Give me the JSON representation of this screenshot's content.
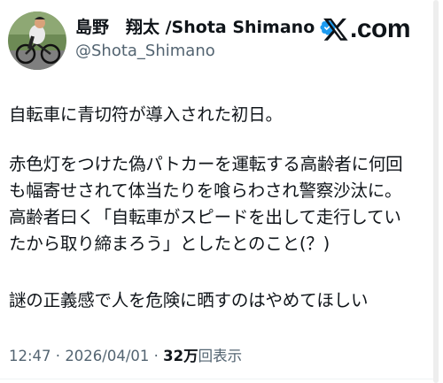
{
  "author": {
    "display_name": "島野　翔太 /Shota Shimano",
    "handle": "@Shota_Shimano",
    "verified_icon": "verified-badge-icon",
    "verified_color": "#1d9bf0",
    "avatar_icon": "cyclist-avatar"
  },
  "brand": {
    "logo_icon": "x-logo-icon",
    "logo_text": ".com"
  },
  "tweet": {
    "lines": [
      "自転車に青切符が導入された初日。",
      "赤色灯をつけた偽パトカーを運転する高齢者に何回",
      "も幅寄せされて体当たりを喰らわされ警察沙汰に。",
      "高齢者曰く「自転車がスピードを出して走行してい",
      "たから取り締まろう」としたとのこと(？)",
      "謎の正義感で人を危険に晒すのはやめてほしい"
    ]
  },
  "meta": {
    "time": "12:47",
    "separator": " · ",
    "date": "2026/04/01",
    "views_count": "32万",
    "views_label": "回表示"
  },
  "colors": {
    "text": "#0f1419",
    "secondary": "#536471"
  }
}
